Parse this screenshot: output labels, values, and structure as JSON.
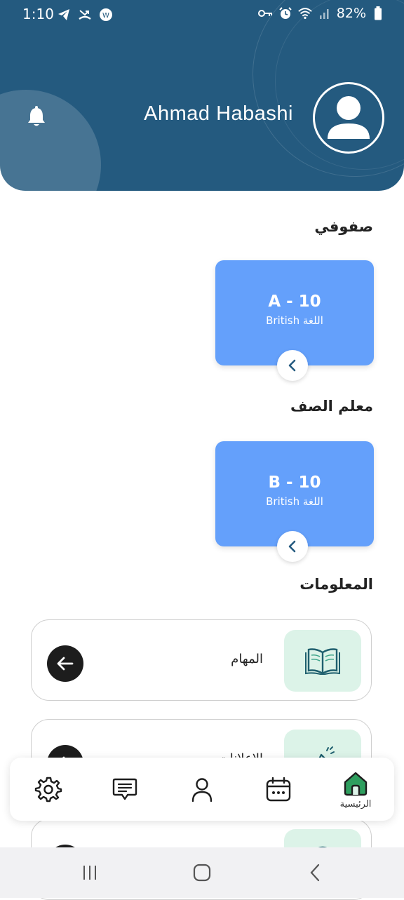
{
  "status_bar": {
    "time": "1:10",
    "battery": "82%"
  },
  "header": {
    "user_name": "Ahmad Habashi"
  },
  "sections": {
    "my_classes_title": "صفوفي",
    "class_teacher_title": "معلم الصف",
    "information_title": "المعلومات"
  },
  "classes": [
    {
      "name": "A - 10",
      "language": "British اللغة"
    }
  ],
  "teacher_classes": [
    {
      "name": "B - 10",
      "language": "British اللغة"
    }
  ],
  "info_items": [
    {
      "label": "المهام",
      "icon": "open-book-icon"
    },
    {
      "label": "الإعلانات",
      "icon": "megaphone-icon"
    },
    {
      "label": "",
      "icon": "location-icon"
    }
  ],
  "bottom_nav": {
    "home_label": "الرئيسية",
    "items": [
      "settings-icon",
      "messages-icon",
      "profile-icon",
      "calendar-icon",
      "home-icon"
    ],
    "active_color": "#2e9e5e"
  },
  "colors": {
    "header": "#245a7f",
    "card": "#64a0fb",
    "icon_box": "#dcf3e8",
    "arrow_button": "#1d1d1d"
  }
}
